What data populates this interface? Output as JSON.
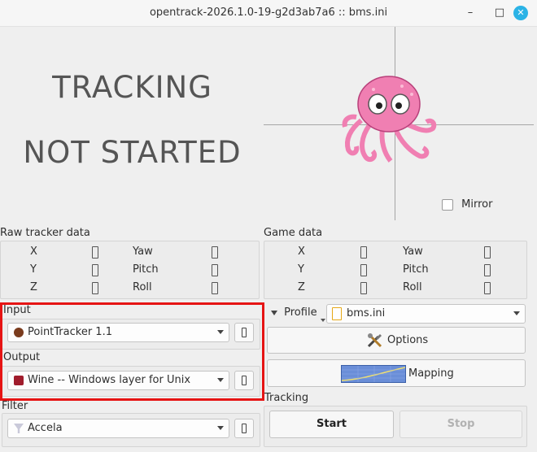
{
  "window": {
    "title": "opentrack-2026.1.0-19-g2d3ab7a6 :: bms.ini",
    "minimize": "–",
    "maximize": "□",
    "close": "✕"
  },
  "status": {
    "line1": "TRACKING",
    "line2": "NOT STARTED"
  },
  "preview": {
    "mirror_label": "Mirror",
    "mirror_checked": false
  },
  "raw": {
    "title": "Raw tracker data",
    "rows": [
      {
        "a": "X",
        "b": "Yaw"
      },
      {
        "a": "Y",
        "b": "Pitch"
      },
      {
        "a": "Z",
        "b": "Roll"
      }
    ]
  },
  "game": {
    "title": "Game data",
    "rows": [
      {
        "a": "X",
        "b": "Yaw"
      },
      {
        "a": "Y",
        "b": "Pitch"
      },
      {
        "a": "Z",
        "b": "Roll"
      }
    ]
  },
  "input": {
    "label": "Input",
    "value": "PointTracker 1.1"
  },
  "output": {
    "label": "Output",
    "value": "Wine -- Windows layer for Unix"
  },
  "filter": {
    "label": "Filter",
    "value": "Accela"
  },
  "profile": {
    "label": "Profile",
    "value": "bms.ini"
  },
  "buttons": {
    "options": "Options",
    "mapping": "Mapping"
  },
  "tracking": {
    "label": "Tracking",
    "start": "Start",
    "stop": "Stop"
  },
  "colors": {
    "highlight": "#e61414",
    "accent": "#2bb3e6",
    "octopus": "#f07fb2"
  }
}
